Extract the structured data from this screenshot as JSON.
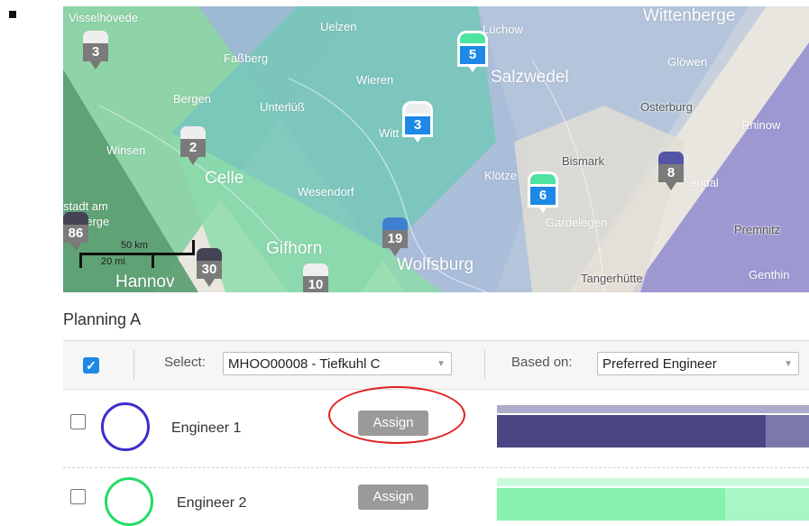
{
  "map": {
    "places": [
      "Visselhövede",
      "Uelzen",
      "Lüchow",
      "Wittenberge",
      "Faßberg",
      "Salzwedel",
      "Glöwen",
      "Wieren",
      "Bergen",
      "Unterlüß",
      "Osterburg",
      "Rhinow",
      "Witt",
      "Winsen",
      "Celle",
      "Bismark",
      "Klötze",
      "endal",
      "Wesendorf",
      "stadt am",
      "berge",
      "Gardelegen",
      "Premnitz",
      "Gifhorn",
      "Wolfsburg",
      "Hannov",
      "Tangerhütte",
      "Genthin"
    ],
    "markers": [
      {
        "count": "3",
        "color": "#7b7b7b"
      },
      {
        "count": "5",
        "color": "#1e88e5"
      },
      {
        "count": "3",
        "color": "#1e88e5"
      },
      {
        "count": "2",
        "color": "#7b7b7b"
      },
      {
        "count": "8",
        "color": "#7b7b7b"
      },
      {
        "count": "6",
        "color": "#1e88e5"
      },
      {
        "count": "19",
        "color": "#7b7b7b"
      },
      {
        "count": "86",
        "color": "#7b7b7b"
      },
      {
        "count": "30",
        "color": "#7b7b7b"
      },
      {
        "count": "10",
        "color": "#7b7b7b"
      }
    ],
    "scale": {
      "km": "50 km",
      "mi": "20 mi"
    }
  },
  "planning": {
    "title": "Planning A",
    "select_label": "Select:",
    "select_value": "MHOO00008 - Tiefkuhl C",
    "based_label": "Based on:",
    "based_value": "Preferred Engineer"
  },
  "engineers": [
    {
      "name": "Engineer 1",
      "assign": "Assign",
      "color": "#3b2fc9",
      "bar_color": "#4a4683",
      "bar_rest": "#7b78ab",
      "bar_top": "#aeaccc",
      "load": 0.86
    },
    {
      "name": "Engineer 2",
      "assign": "Assign",
      "color": "#22dd66",
      "bar_color": "#86f2ad",
      "bar_rest": "#a9f6c5",
      "bar_top": "#c9f9dc",
      "load": 0.73
    }
  ]
}
